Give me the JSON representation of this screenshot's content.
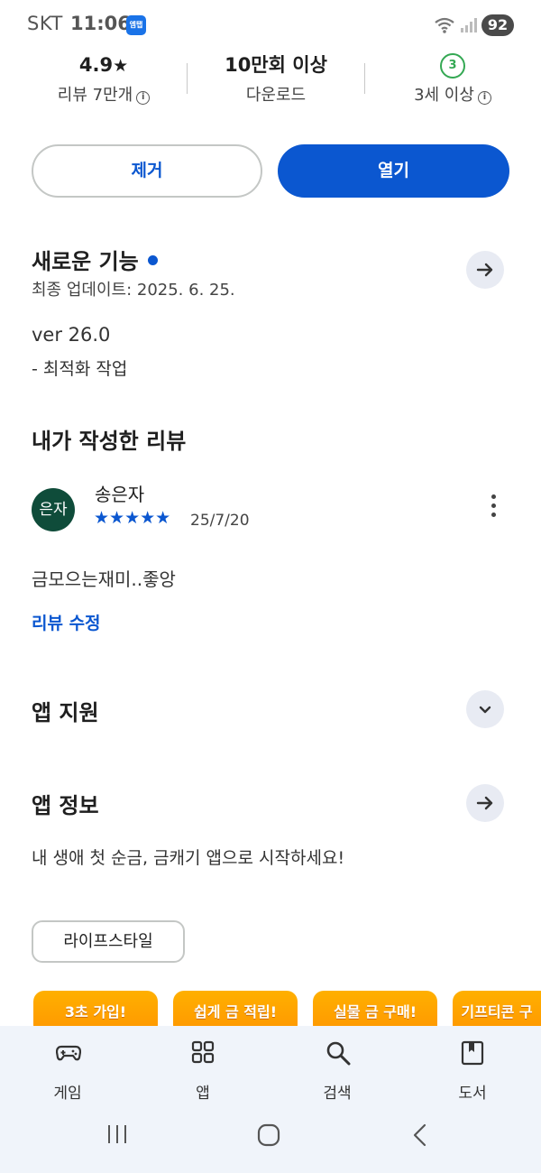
{
  "status_bar": {
    "carrier": "SKT",
    "time": "11:06",
    "notif_icon_text": "엠탭",
    "battery": "92"
  },
  "stats": {
    "rating": "4.9",
    "rating_label": "리뷰 7만개",
    "downloads": "10만회 이상",
    "downloads_label": "다운로드",
    "age_badge": "3",
    "age_label": "3세 이상"
  },
  "actions": {
    "uninstall": "제거",
    "open": "열기"
  },
  "whats_new": {
    "title": "새로운 기능",
    "updated": "최종 업데이트: 2025. 6. 25.",
    "version": "ver 26.0",
    "note": "- 최적화 작업"
  },
  "my_review": {
    "title": "내가 작성한 리뷰",
    "avatar_text": "은자",
    "reviewer": "송은자",
    "rating_stars": 5,
    "stars_display": "★★★★★",
    "date": "25/7/20",
    "body": "금모으는재미..좋앙",
    "edit": "리뷰 수정"
  },
  "app_support": {
    "title": "앱 지원"
  },
  "app_info": {
    "title": "앱 정보",
    "description": "내 생애 첫 순금, 금캐기 앱으로 시작하세요!",
    "category": "라이프스타일"
  },
  "promos": [
    "3초 가입!",
    "쉽게 금 적립!",
    "실물 금 구매!",
    "기프티콘 구"
  ],
  "bottom_nav": [
    {
      "label": "게임",
      "icon": "gamepad-icon"
    },
    {
      "label": "앱",
      "icon": "apps-grid-icon"
    },
    {
      "label": "검색",
      "icon": "search-icon"
    },
    {
      "label": "도서",
      "icon": "book-icon"
    }
  ],
  "colors": {
    "accent": "#0b57d0",
    "avatar_bg": "#0f4c3a",
    "age_green": "#34a853",
    "promo": "#ffa200",
    "nav_bg": "#f0f4fa"
  }
}
